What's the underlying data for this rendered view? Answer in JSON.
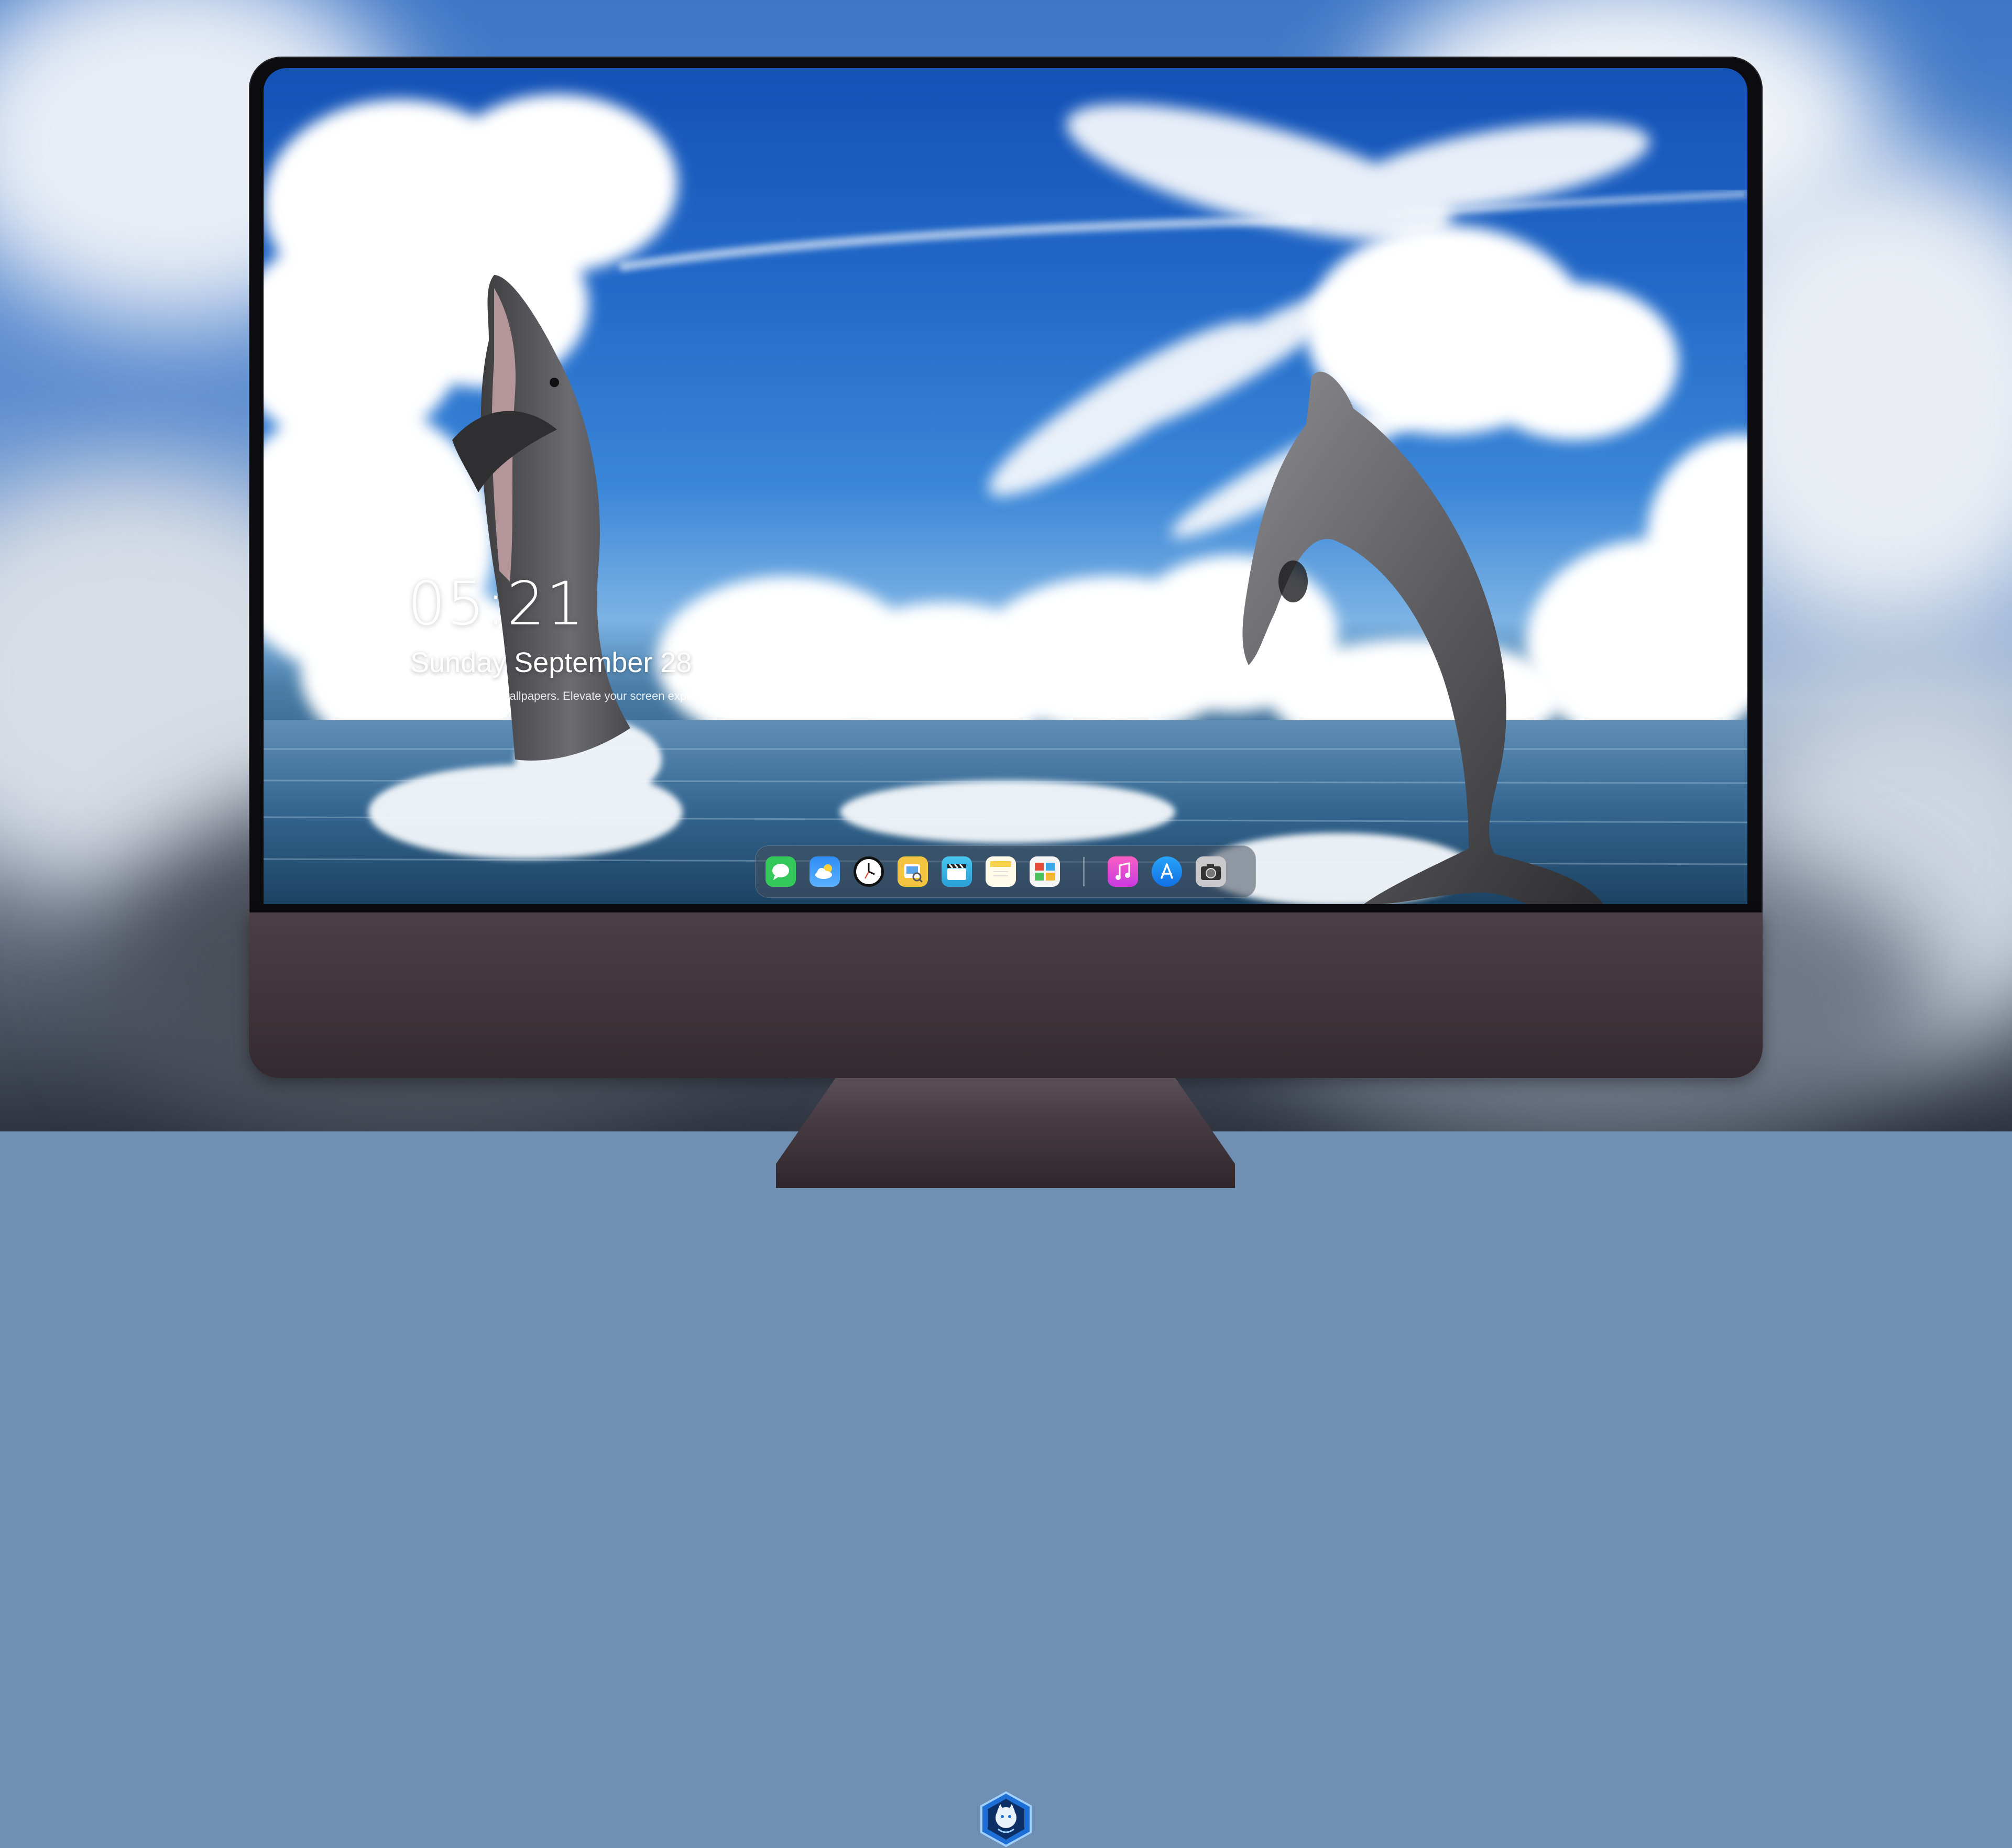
{
  "lock_screen": {
    "time": "05:21",
    "date": "Sunday September  28",
    "tagline": "Preview stunning wallpapers. Elevate your screen experience | Bizhimi CN"
  },
  "dock": {
    "apps": [
      {
        "name": "messages-icon",
        "color": "#34c759"
      },
      {
        "name": "weather-icon",
        "color": "#2f8cf4"
      },
      {
        "name": "clock-icon",
        "color": "#ffffff"
      },
      {
        "name": "preview-icon",
        "color": "#f3c440"
      },
      {
        "name": "clips-icon",
        "color": "#3bb8e8"
      },
      {
        "name": "notes-icon",
        "color": "#f7d14a"
      },
      {
        "name": "photo-booth-icon",
        "color": "#e64b3a"
      },
      {
        "name": "music-icon",
        "color": "#e84aa8"
      },
      {
        "name": "app-store-icon",
        "color": "#1d8cf5"
      },
      {
        "name": "camera-icon",
        "color": "#8a8a8e"
      }
    ]
  },
  "colors": {
    "sky_top": "#1452b6",
    "sea": "#305f86",
    "chin": "#3d3338"
  }
}
